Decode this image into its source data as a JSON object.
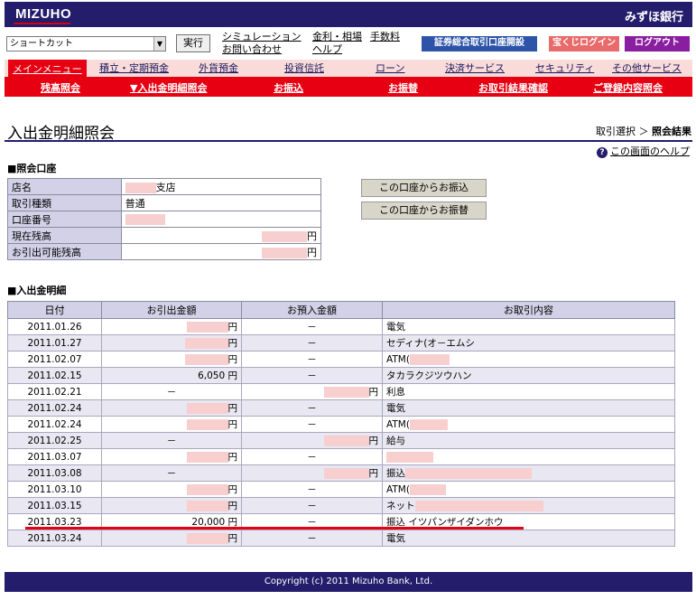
{
  "header": {
    "logo": "MIZUHO",
    "bank_name": "みずほ銀行"
  },
  "toolbar": {
    "shortcut_value": "ショートカット",
    "exec_label": "実行",
    "links": [
      "シミュレーション",
      "お問い合わせ",
      "金利・相場",
      "ヘルプ",
      "手数料"
    ],
    "pills": [
      {
        "label": "証券総合取引口座開設",
        "color": "#2d54a8"
      },
      {
        "label": "宝くじログイン",
        "color": "#e86a6a"
      },
      {
        "label": "ログアウト",
        "color": "#8a1ea0"
      }
    ]
  },
  "nav": {
    "tabs": [
      "メインメニュー",
      "積立・定期預金",
      "外貨預金",
      "投資信託",
      "ローン",
      "決済サービス",
      "セキュリティ",
      "その他サービス"
    ],
    "subtabs": [
      "残高照会",
      "▼入出金明細照会",
      "お振込",
      "お振替",
      "お取引結果確認",
      "ご登録内容照会"
    ]
  },
  "page": {
    "title": "入出金明細照会",
    "breadcrumb_prev": "取引選択",
    "breadcrumb_sep": "＞",
    "breadcrumb_current": "照会結果",
    "help": "この画面のヘルプ"
  },
  "account": {
    "heading": "■照会口座",
    "rows": [
      {
        "label": "店名",
        "value": "支店"
      },
      {
        "label": "取引種類",
        "value": "普通"
      },
      {
        "label": "口座番号",
        "value": ""
      },
      {
        "label": "現在残高",
        "value": "円"
      },
      {
        "label": "お引出可能残高",
        "value": "円"
      }
    ],
    "buttons": [
      "この口座からお振込",
      "この口座からお振替"
    ]
  },
  "transactions": {
    "heading": "■入出金明細",
    "columns": [
      "日付",
      "お引出金額",
      "お預入金額",
      "お取引内容"
    ],
    "rows": [
      {
        "date": "2011.01.26",
        "out": "円",
        "in": "－",
        "desc": "電気"
      },
      {
        "date": "2011.01.27",
        "out": "円",
        "in": "－",
        "desc": "セディナ(オ－エムシ"
      },
      {
        "date": "2011.02.07",
        "out": "円",
        "in": "－",
        "desc": "ATM("
      },
      {
        "date": "2011.02.15",
        "out": "6,050 円",
        "in": "－",
        "desc": "タカラクジツウハン"
      },
      {
        "date": "2011.02.21",
        "out": "－",
        "in": "円",
        "desc": "利息"
      },
      {
        "date": "2011.02.24",
        "out": "円",
        "in": "－",
        "desc": "電気"
      },
      {
        "date": "2011.02.24",
        "out": "円",
        "in": "－",
        "desc": "ATM("
      },
      {
        "date": "2011.02.25",
        "out": "－",
        "in": "円",
        "desc": "給与"
      },
      {
        "date": "2011.03.07",
        "out": "円",
        "in": "－",
        "desc": ""
      },
      {
        "date": "2011.03.08",
        "out": "－",
        "in": "円",
        "desc": "振込"
      },
      {
        "date": "2011.03.10",
        "out": "円",
        "in": "－",
        "desc": "ATM("
      },
      {
        "date": "2011.03.15",
        "out": "円",
        "in": "－",
        "desc": "ネット"
      },
      {
        "date": "2011.03.23",
        "out": "20,000 円",
        "in": "－",
        "desc": "振込 イツパンザイダンホウ"
      },
      {
        "date": "2011.03.24",
        "out": "円",
        "in": "－",
        "desc": "電気"
      }
    ]
  },
  "footer": {
    "copyright": "Copyright (c) 2011 Mizuho Bank, Ltd."
  }
}
